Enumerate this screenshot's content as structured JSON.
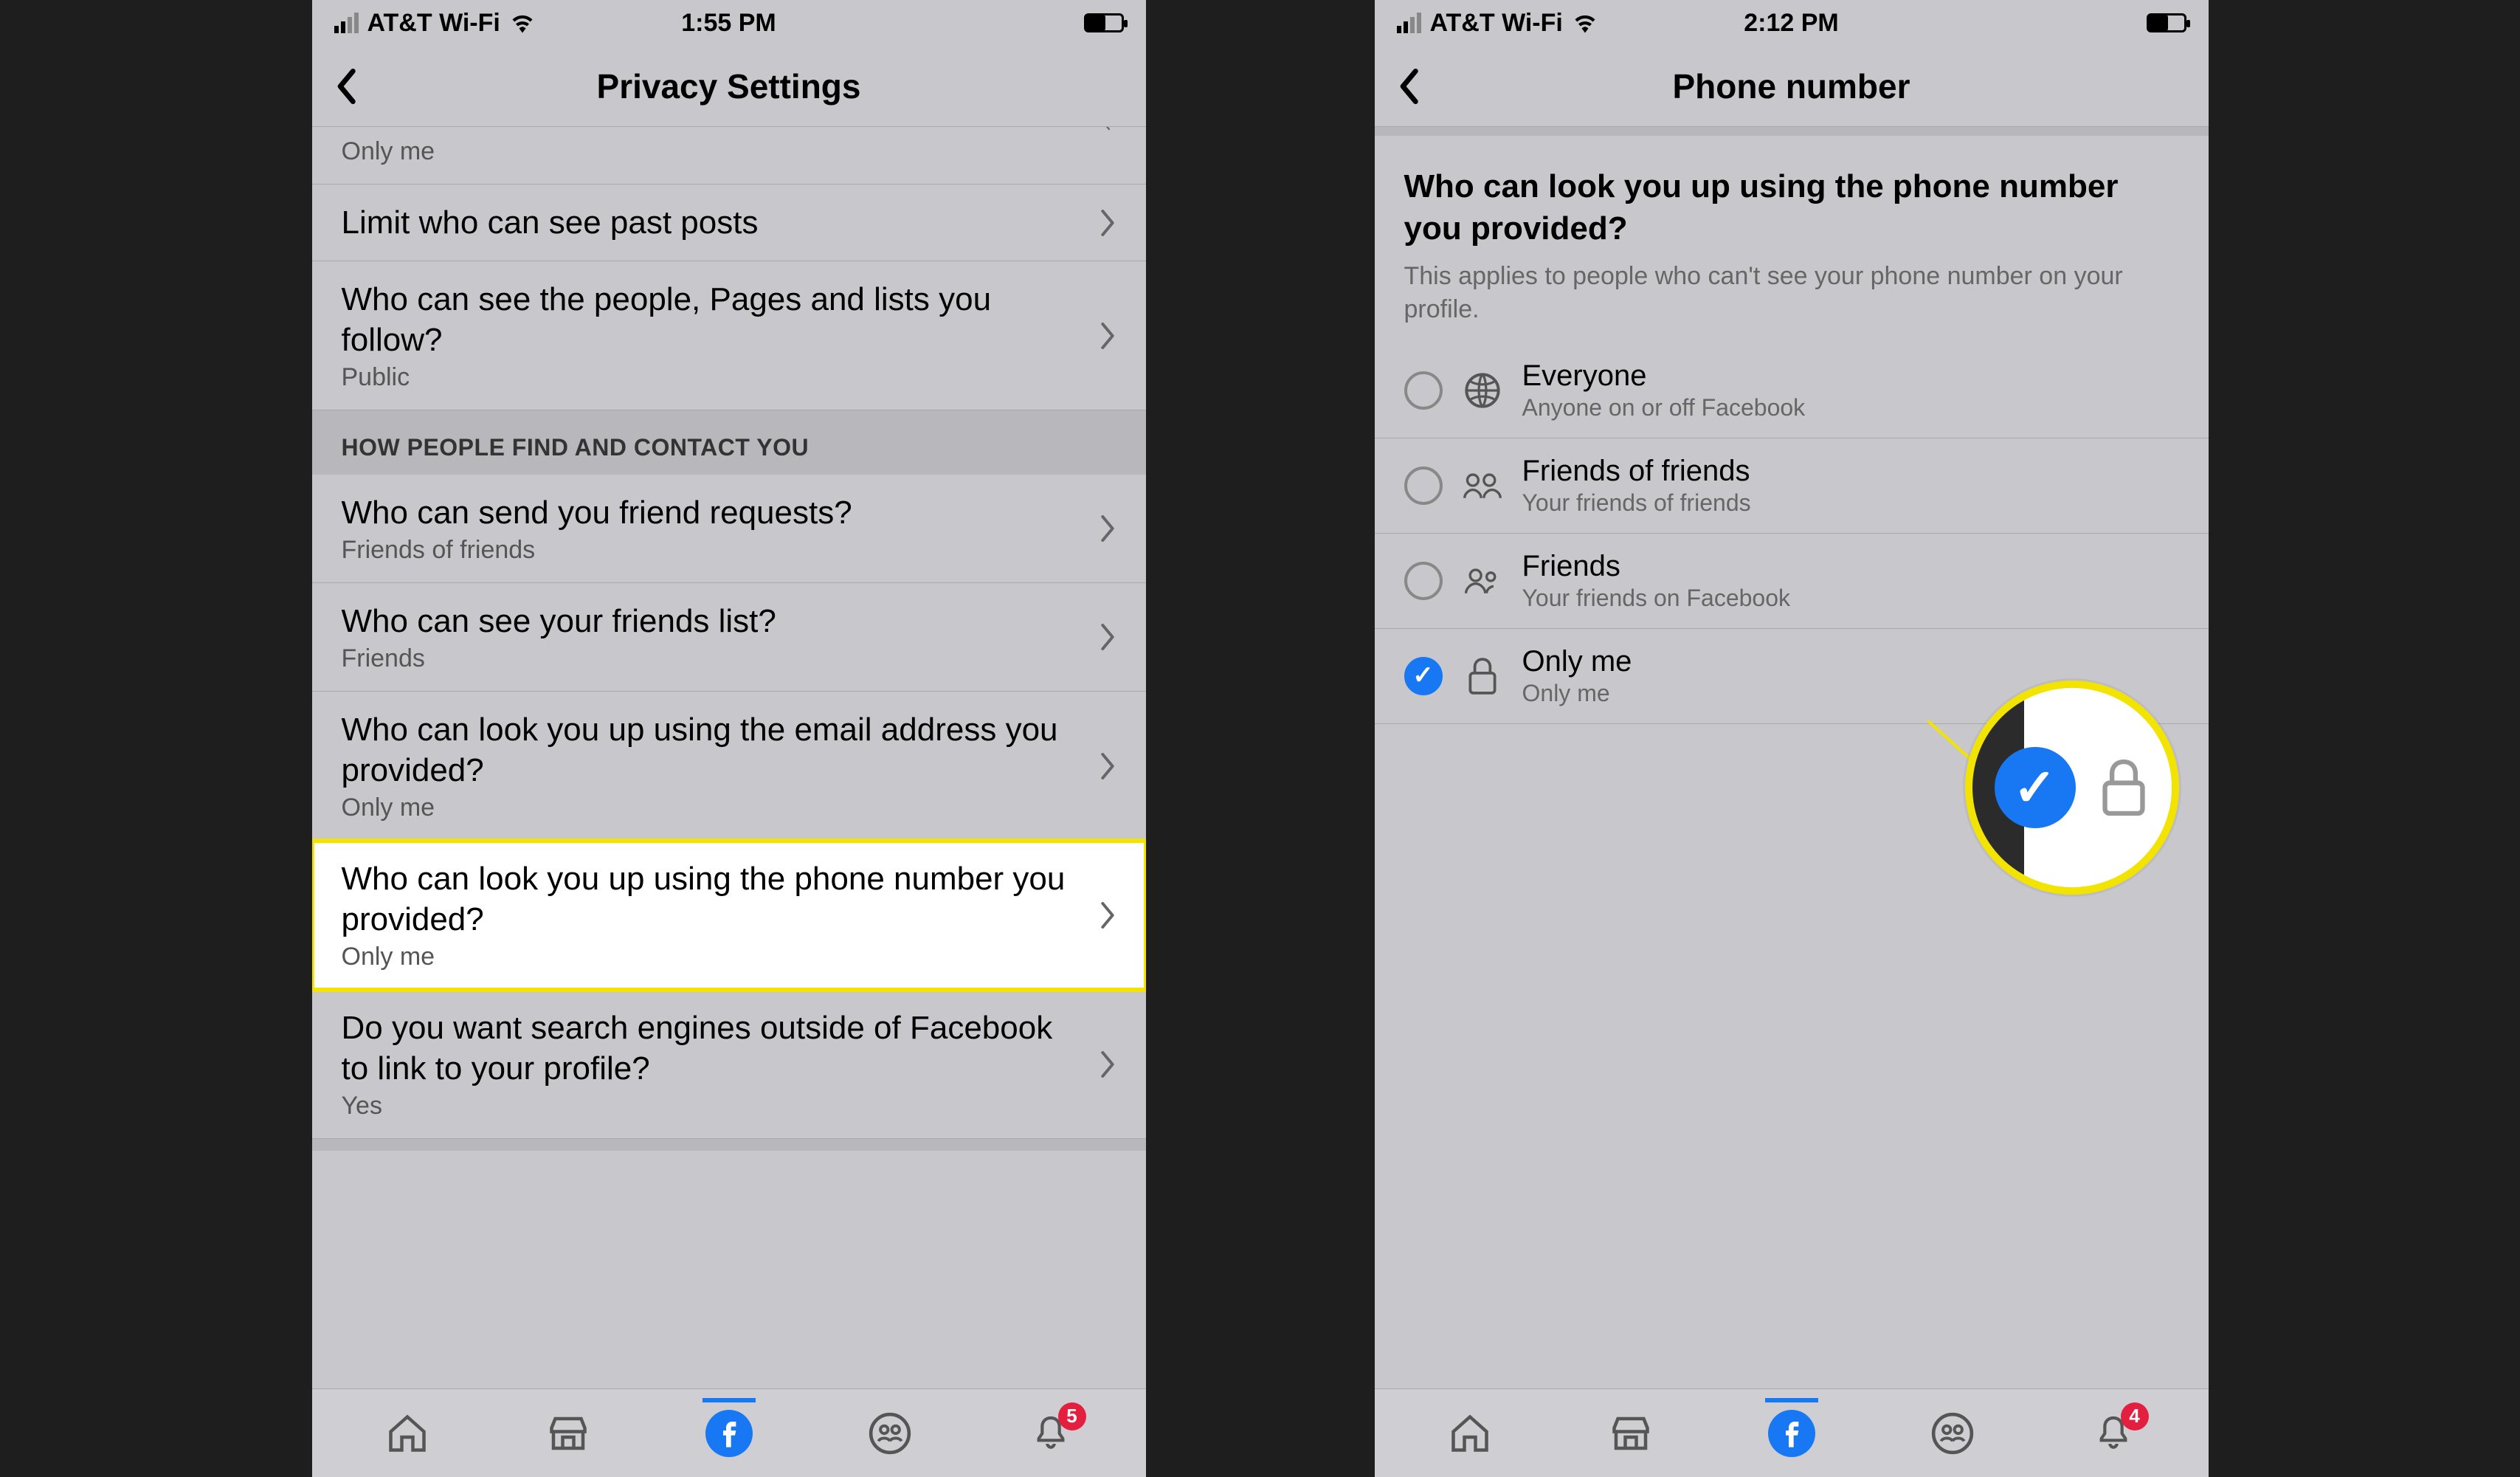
{
  "phone1": {
    "status": {
      "carrier": "AT&T Wi-Fi",
      "time": "1:55 PM"
    },
    "title": "Privacy Settings",
    "partial_sub": "Only me",
    "rows": {
      "limit": {
        "title": "Limit who can see past posts"
      },
      "follow": {
        "title": "Who can see the people, Pages and lists you follow?",
        "sub": "Public"
      }
    },
    "section_header": "HOW PEOPLE FIND AND CONTACT YOU",
    "contact_rows": {
      "friend_req": {
        "title": "Who can send you friend requests?",
        "sub": "Friends of friends"
      },
      "friends_list": {
        "title": "Who can see your friends list?",
        "sub": "Friends"
      },
      "email": {
        "title": "Who can look you up using the email address you provided?",
        "sub": "Only me"
      },
      "phone": {
        "title": "Who can look you up using the phone number you provided?",
        "sub": "Only me"
      },
      "search": {
        "title": "Do you want search engines outside of Facebook to link to your profile?",
        "sub": "Yes"
      }
    },
    "badge": "5"
  },
  "phone2": {
    "status": {
      "carrier": "AT&T Wi-Fi",
      "time": "2:12 PM"
    },
    "title": "Phone number",
    "question": "Who can look you up using the phone number you provided?",
    "desc": "This applies to people who can't see your phone number on your profile.",
    "options": {
      "everyone": {
        "label": "Everyone",
        "desc": "Anyone on or off Facebook"
      },
      "fof": {
        "label": "Friends of friends",
        "desc": "Your friends of friends"
      },
      "friends": {
        "label": "Friends",
        "desc": "Your friends on Facebook"
      },
      "onlyme": {
        "label": "Only me",
        "desc": "Only me"
      }
    },
    "badge": "4"
  }
}
